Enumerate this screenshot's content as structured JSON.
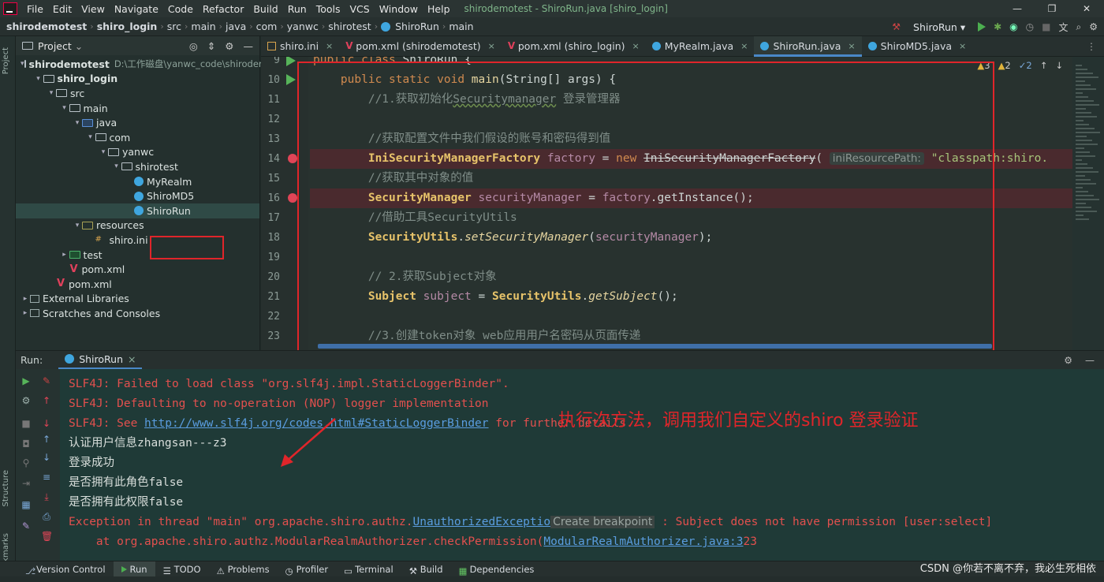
{
  "menu": {
    "items": [
      "File",
      "Edit",
      "View",
      "Navigate",
      "Code",
      "Refactor",
      "Build",
      "Run",
      "Tools",
      "VCS",
      "Window",
      "Help"
    ],
    "window_title": "shirodemotest - ShiroRun.java [shiro_login]"
  },
  "nav": {
    "crumbs": [
      "shirodemotest",
      "shiro_login",
      "src",
      "main",
      "java",
      "com",
      "yanwc",
      "shirotest",
      "ShiroRun",
      "main"
    ],
    "run_config": "ShiroRun"
  },
  "project": {
    "title": "Project",
    "tree": [
      {
        "label": "shirodemotest",
        "path": "D:\\工作磁盘\\yanwc_code\\shirodem",
        "indent": 0,
        "arrow": "▾",
        "icon": "folder",
        "bold": true
      },
      {
        "label": "shiro_login",
        "indent": 1,
        "arrow": "▾",
        "icon": "folder",
        "bold": true
      },
      {
        "label": "src",
        "indent": 2,
        "arrow": "▾",
        "icon": "folder"
      },
      {
        "label": "main",
        "indent": 3,
        "arrow": "▾",
        "icon": "folder"
      },
      {
        "label": "java",
        "indent": 4,
        "arrow": "▾",
        "icon": "folder blue"
      },
      {
        "label": "com",
        "indent": 5,
        "arrow": "▾",
        "icon": "folder"
      },
      {
        "label": "yanwc",
        "indent": 6,
        "arrow": "▾",
        "icon": "folder"
      },
      {
        "label": "shirotest",
        "indent": 7,
        "arrow": "▾",
        "icon": "folder"
      },
      {
        "label": "MyRealm",
        "indent": 8,
        "arrow": "",
        "icon": "jclass"
      },
      {
        "label": "ShiroMD5",
        "indent": 8,
        "arrow": "",
        "icon": "jclass"
      },
      {
        "label": "ShiroRun",
        "indent": 8,
        "arrow": "",
        "icon": "jclass"
      },
      {
        "label": "resources",
        "indent": 4,
        "arrow": "▾",
        "icon": "folder res"
      },
      {
        "label": "shiro.ini",
        "indent": 5,
        "arrow": "",
        "icon": "ini"
      },
      {
        "label": "test",
        "indent": 3,
        "arrow": "▸",
        "icon": "folder test"
      },
      {
        "label": "pom.xml",
        "indent": 3,
        "arrow": "",
        "icon": "xml"
      },
      {
        "label": "pom.xml",
        "indent": 2,
        "arrow": "",
        "icon": "xml"
      },
      {
        "label": "External Libraries",
        "indent": 0,
        "arrow": "▸",
        "icon": "lib"
      },
      {
        "label": "Scratches and Consoles",
        "indent": 0,
        "arrow": "▸",
        "icon": "lib"
      }
    ]
  },
  "tabs": [
    {
      "label": "shiro.ini",
      "icon": "ini2"
    },
    {
      "label": "pom.xml (shirodemotest)",
      "icon": "x"
    },
    {
      "label": "pom.xml (shiro_login)",
      "icon": "x"
    },
    {
      "label": "MyRealm.java",
      "icon": "j"
    },
    {
      "label": "ShiroRun.java",
      "icon": "j",
      "active": true
    },
    {
      "label": "ShiroMD5.java",
      "icon": "j"
    }
  ],
  "editor": {
    "line_numbers": [
      "9",
      "10",
      "11",
      "12",
      "13",
      "14",
      "15",
      "16",
      "17",
      "18",
      "19",
      "20",
      "21",
      "22",
      "23"
    ],
    "inspections": {
      "warnings": "3",
      "weak": "2",
      "typos": "2"
    },
    "param_hint": "iniResourcePath:",
    "code": {
      "l9a": "public class ",
      "l9b": "ShiroRun {",
      "l10a": "    public static void ",
      "l10b": "main",
      "l10c": "(",
      "l10d": "String",
      "l10e": "[] args) {",
      "l11a": "        //1.获取初始化",
      "l11b": "Securitymanager",
      "l11c": " 登录管理器",
      "l13": "        //获取配置文件中我们假设的账号和密码得到值",
      "l14a": "        ",
      "l14b": "IniSecurityManagerFactory",
      "l14c": " factory",
      "l14d": " = ",
      "l14e": "new ",
      "l14f": "IniSecurityManagerFactory",
      "l14g": "( ",
      "l14h": " \"classpath:shiro.",
      "l15": "        //获取其中对象的值",
      "l16a": "        ",
      "l16b": "SecurityManager",
      "l16c": " securityManager",
      "l16d": " = ",
      "l16e": "factory",
      "l16f": ".getInstance();",
      "l17": "        //借助工具SecurityUtils",
      "l18a": "        ",
      "l18b": "SecurityUtils",
      "l18c": ".",
      "l18d": "setSecurityManager",
      "l18e": "(",
      "l18f": "securityManager",
      "l18g": ");",
      "l20": "        // 2.获取Subject对象",
      "l21a": "        ",
      "l21b": "Subject",
      "l21c": " subject",
      "l21d": " = ",
      "l21e": "SecurityUtils",
      "l21f": ".",
      "l21g": "getSubject",
      "l21h": "();",
      "l23": "        //3.创建token对象 web应用用户名密码从页面传递"
    }
  },
  "run": {
    "label": "Run:",
    "tab": "ShiroRun",
    "console": {
      "l1": "SLF4J: Failed to load class \"org.slf4j.impl.StaticLoggerBinder\".",
      "l2": "SLF4J: Defaulting to no-operation (NOP) logger implementation",
      "l3a": "SLF4J: See ",
      "l3b": "http://www.slf4j.org/codes.html#StaticLoggerBinder",
      "l3c": " for further details.",
      "l4": "认证用户信息zhangsan---z3",
      "l5": "登录成功",
      "l6": "是否拥有此角色false",
      "l7": "是否拥有此权限false",
      "l8a": "Exception in thread \"main\" org.apache.shiro.authz.",
      "l8b": "UnauthorizedExceptio",
      "l8c": "Create breakpoint",
      "l8d": " : Subject does not have permission [user:select]",
      "l9a": "    at org.apache.shiro.authz.ModularRealmAuthorizer.checkPermission(",
      "l9b": "ModularRealmAuthorizer.java:3",
      "l9c": "23"
    },
    "annotation": "执行次方法，调用我们自定义的shiro 登录验证"
  },
  "bottom": {
    "tools": [
      "Version Control",
      "Run",
      "TODO",
      "Problems",
      "Profiler",
      "Terminal",
      "Build",
      "Dependencies"
    ],
    "watermark": "CSDN @你若不离不弃，我必生死相依"
  },
  "sidebar_labels": {
    "project": "Project",
    "structure": "Structure",
    "bookmarks": "Bookmarks"
  },
  "colors": {
    "highlight_box": "#e0252a",
    "breakpoint": "#e04557",
    "run": "#57b45a"
  }
}
